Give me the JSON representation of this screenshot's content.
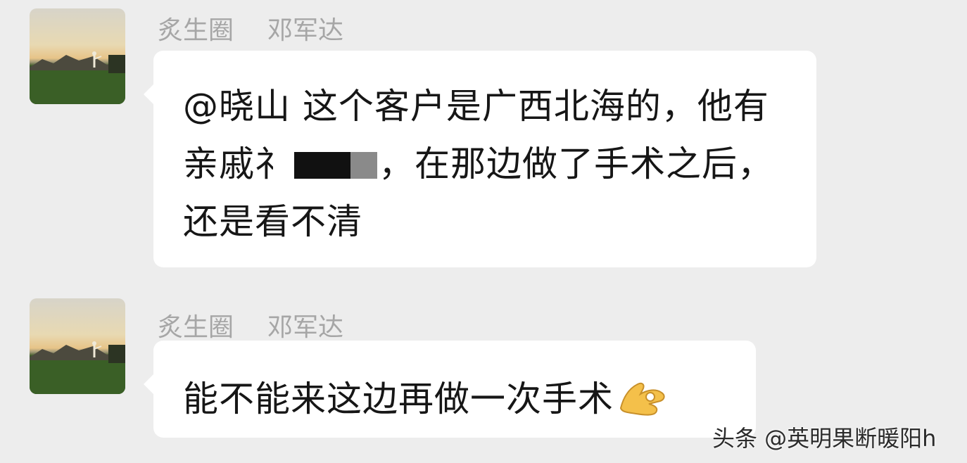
{
  "messages": [
    {
      "group_name": "炙生圈",
      "sender_name": "邓军达",
      "text_before_redaction": "@晓山  这个客户是广西北海的，他有亲戚",
      "partial_char": "礻",
      "text_after_redaction": "，在那边做了手术之后，还是看不清",
      "avatar_icon": "sunset-field-icon"
    },
    {
      "group_name": "炙生圈",
      "sender_name": "邓军达",
      "text": "能不能来这边再做一次手术",
      "emoji_icon": "ok-hand-icon"
    }
  ],
  "watermark": "头条 @英明果断暖阳h",
  "colors": {
    "background": "#ededed",
    "bubble": "#ffffff",
    "meta_text": "#a6a6a6",
    "message_text": "#161616"
  }
}
